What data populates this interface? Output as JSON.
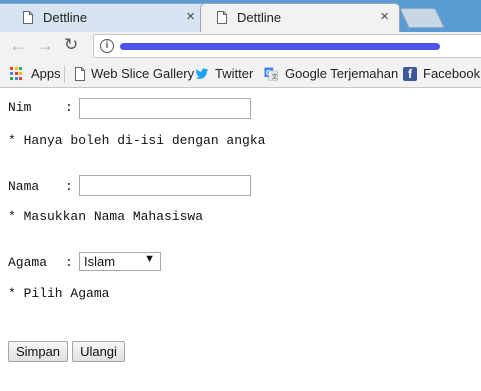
{
  "tabs": [
    {
      "title": "Dettline",
      "close": "×",
      "active": false
    },
    {
      "title": "Dettline",
      "close": "×",
      "active": true
    }
  ],
  "toolbar": {
    "back": "←",
    "forward": "→",
    "reload": "↻",
    "info": "i"
  },
  "bookmarks": {
    "apps": "Apps",
    "items": [
      {
        "label": "Web Slice Gallery",
        "icon": "page-icon"
      },
      {
        "label": "Twitter",
        "icon": "twitter-bird-icon"
      },
      {
        "label": "Google Terjemahan",
        "icon": "google-translate-icon"
      },
      {
        "label": "Facebook",
        "icon": "facebook-icon"
      }
    ],
    "facebook_glyph": "f"
  },
  "form": {
    "nim": {
      "label": "Nim",
      "colon": ":",
      "value": "",
      "hint": "* Hanya boleh di-isi dengan angka"
    },
    "nama": {
      "label": "Nama",
      "colon": ":",
      "value": "",
      "hint": "* Masukkan Nama Mahasiswa"
    },
    "agama": {
      "label": "Agama",
      "colon": ":",
      "selected": "Islam",
      "arrow": "▼",
      "hint": "* Pilih Agama"
    },
    "save_label": "Simpan",
    "reset_label": "Ulangi"
  },
  "colors": {
    "tabstrip": "#5a9bd4",
    "url_scribble": "#4a55e8",
    "facebook": "#3b5998",
    "twitter": "#1da1f2"
  }
}
